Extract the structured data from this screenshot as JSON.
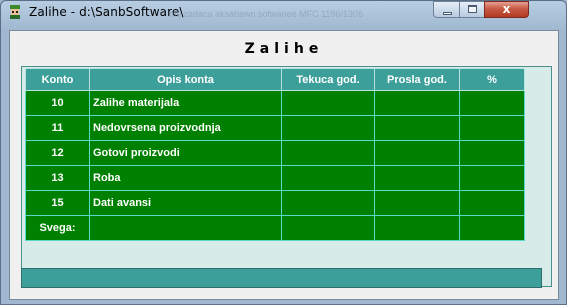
{
  "window": {
    "title": "Zalihe - d:\\SanbSoftware\\",
    "ghost_title": "mtj zadaca                 aksabawn sofwanee          MFC  1196/1306",
    "close_label": "x"
  },
  "form": {
    "heading": "Zalihe"
  },
  "table": {
    "columns": [
      "Konto",
      "Opis konta",
      "Tekuca god.",
      "Prosla god.",
      "%"
    ],
    "rows": [
      {
        "konto": "10",
        "opis": "Zalihe materijala",
        "tekuca": "",
        "prosla": "",
        "pct": ""
      },
      {
        "konto": "11",
        "opis": "Nedovrsena proizvodnja",
        "tekuca": "",
        "prosla": "",
        "pct": ""
      },
      {
        "konto": "12",
        "opis": "Gotovi proizvodi",
        "tekuca": "",
        "prosla": "",
        "pct": ""
      },
      {
        "konto": "13",
        "opis": "Roba",
        "tekuca": "",
        "prosla": "",
        "pct": ""
      },
      {
        "konto": "15",
        "opis": "Dati avansi",
        "tekuca": "",
        "prosla": "",
        "pct": ""
      },
      {
        "konto": "Svega:",
        "opis": "",
        "tekuca": "",
        "prosla": "",
        "pct": ""
      }
    ]
  },
  "colors": {
    "header_bg": "#3c9f9a",
    "row_bg": "#008000",
    "grid_line": "#5ad8c9"
  }
}
